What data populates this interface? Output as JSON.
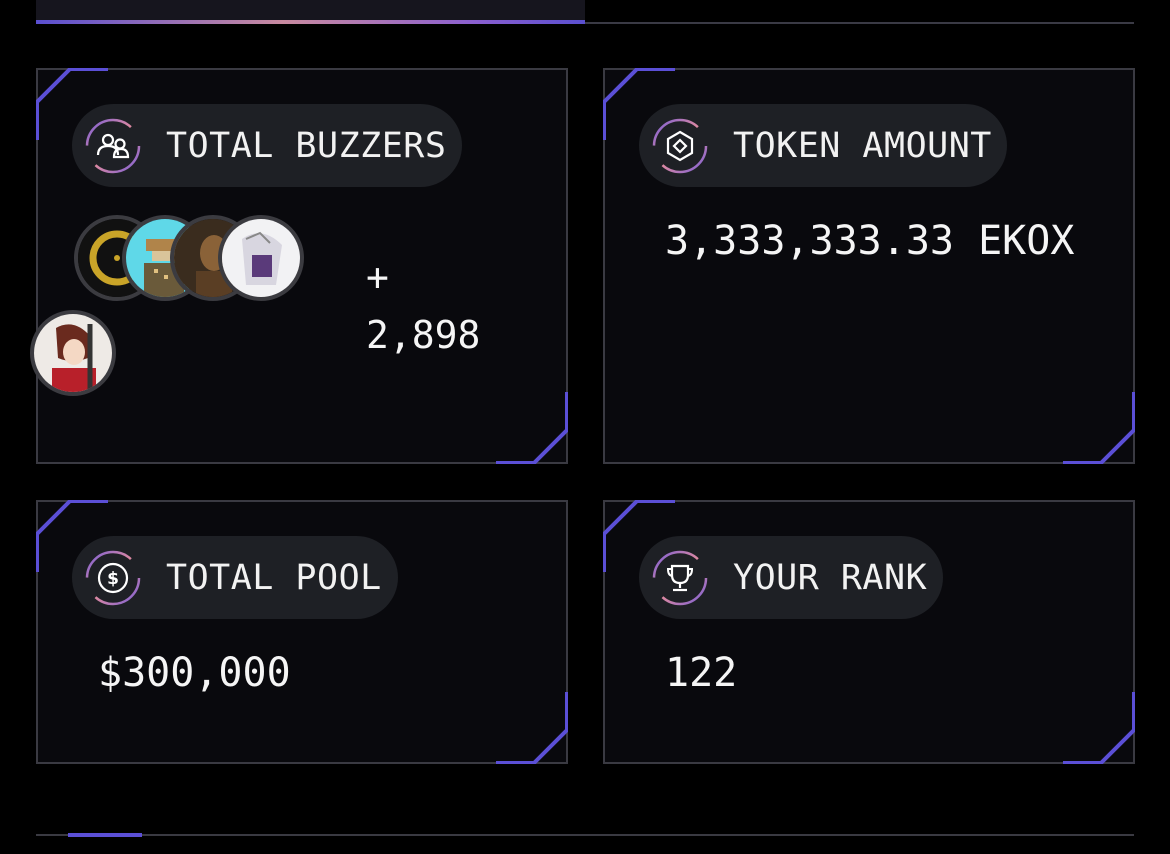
{
  "colors": {
    "accent": "#5b4fd6",
    "card_bg": "#09090d",
    "pill_bg": "#1e2025",
    "border": "#3a3a42"
  },
  "cards": {
    "buzzers": {
      "icon": "users-icon",
      "label": "TOTAL BUZZERS",
      "more_prefix": "+",
      "more_count": "2,898",
      "avatars": [
        "avatar-1",
        "avatar-2",
        "avatar-3",
        "avatar-4",
        "avatar-5"
      ]
    },
    "token": {
      "icon": "token-icon",
      "label": "TOKEN AMOUNT",
      "value": "3,333,333.33 EKOX"
    },
    "pool": {
      "icon": "dollar-coin-icon",
      "label": "TOTAL POOL",
      "value": "$300,000"
    },
    "rank": {
      "icon": "trophy-icon",
      "label": "YOUR RANK",
      "value": "122"
    }
  }
}
